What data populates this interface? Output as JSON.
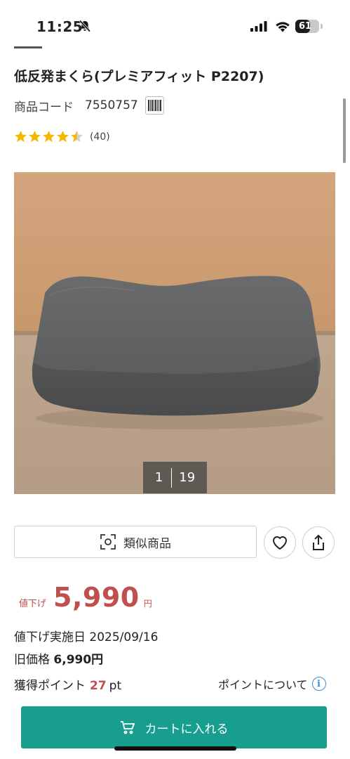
{
  "status_bar": {
    "time": "11:25",
    "battery": "61",
    "icons": [
      "bell-slash-icon",
      "cellular-signal-icon",
      "wifi-icon",
      "battery-icon"
    ]
  },
  "product": {
    "title": "低反発まくら(プレミアフィット P2207)",
    "code_label": "商品コード",
    "code_value": "7550757",
    "rating": 4.5,
    "review_count": "(40)",
    "image_counter": {
      "current": "1",
      "total": "19"
    }
  },
  "actions": {
    "similar_label": "類似商品",
    "favorite_icon": "heart-icon",
    "share_icon": "share-icon"
  },
  "price": {
    "tag": "値下げ",
    "value": "5,990",
    "unit": "円"
  },
  "details": {
    "markdown_date": "値下げ実施日 2025/09/16",
    "old_price_label": "旧価格",
    "old_price_value": "6,990円",
    "points_label": "獲得ポイント",
    "points_value": "27",
    "points_unit": "pt",
    "points_about": "ポイントについて"
  },
  "cart": {
    "label": "カートに入れる"
  },
  "colors": {
    "accent_price": "#c0504d",
    "cart_button": "#189e8f",
    "star": "#f5b800",
    "info_icon": "#3a8fd8"
  }
}
